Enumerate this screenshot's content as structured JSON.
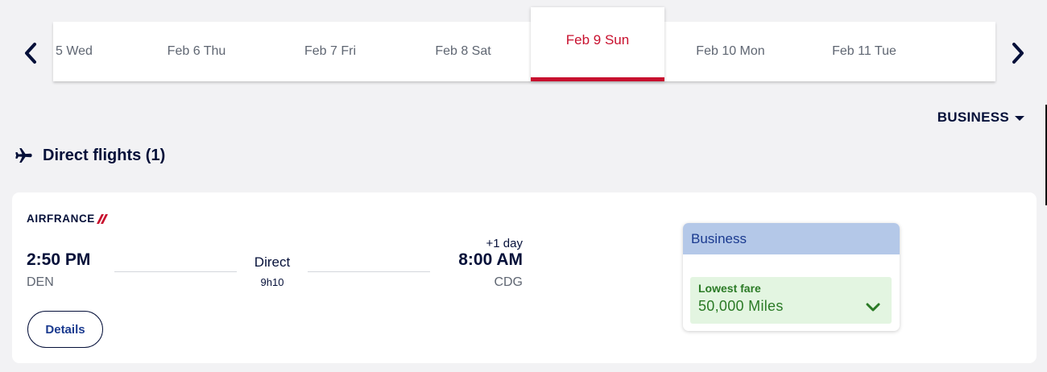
{
  "dates": [
    {
      "label": "5 Wed",
      "active": false
    },
    {
      "label": "Feb 6 Thu",
      "active": false
    },
    {
      "label": "Feb 7 Fri",
      "active": false
    },
    {
      "label": "Feb 8 Sat",
      "active": false
    },
    {
      "label": "Feb 9 Sun",
      "active": true
    },
    {
      "label": "Feb 10 Mon",
      "active": false
    },
    {
      "label": "Feb 11 Tue",
      "active": false
    }
  ],
  "cabin_selector": {
    "label": "BUSINESS"
  },
  "section": {
    "title": "Direct flights (1)"
  },
  "flight": {
    "airline": "AIRFRANCE",
    "departure_time": "2:50 PM",
    "departure_code": "DEN",
    "arrival_time": "8:00 AM",
    "arrival_code": "CDG",
    "day_offset": "+1 day",
    "stops": "Direct",
    "duration": "9h10",
    "details_label": "Details"
  },
  "fare": {
    "cabin": "Business",
    "option_label": "Lowest fare",
    "option_value": "50,000 Miles"
  },
  "colors": {
    "accent_red": "#c8102e",
    "navy": "#051039",
    "fare_header_bg": "#b4c8e8",
    "fare_green": "#2a7a25"
  },
  "icons": {
    "prev": "chevron-left-icon",
    "next": "chevron-right-icon",
    "section": "airplane-icon",
    "fare_toggle": "chevron-down-icon"
  }
}
